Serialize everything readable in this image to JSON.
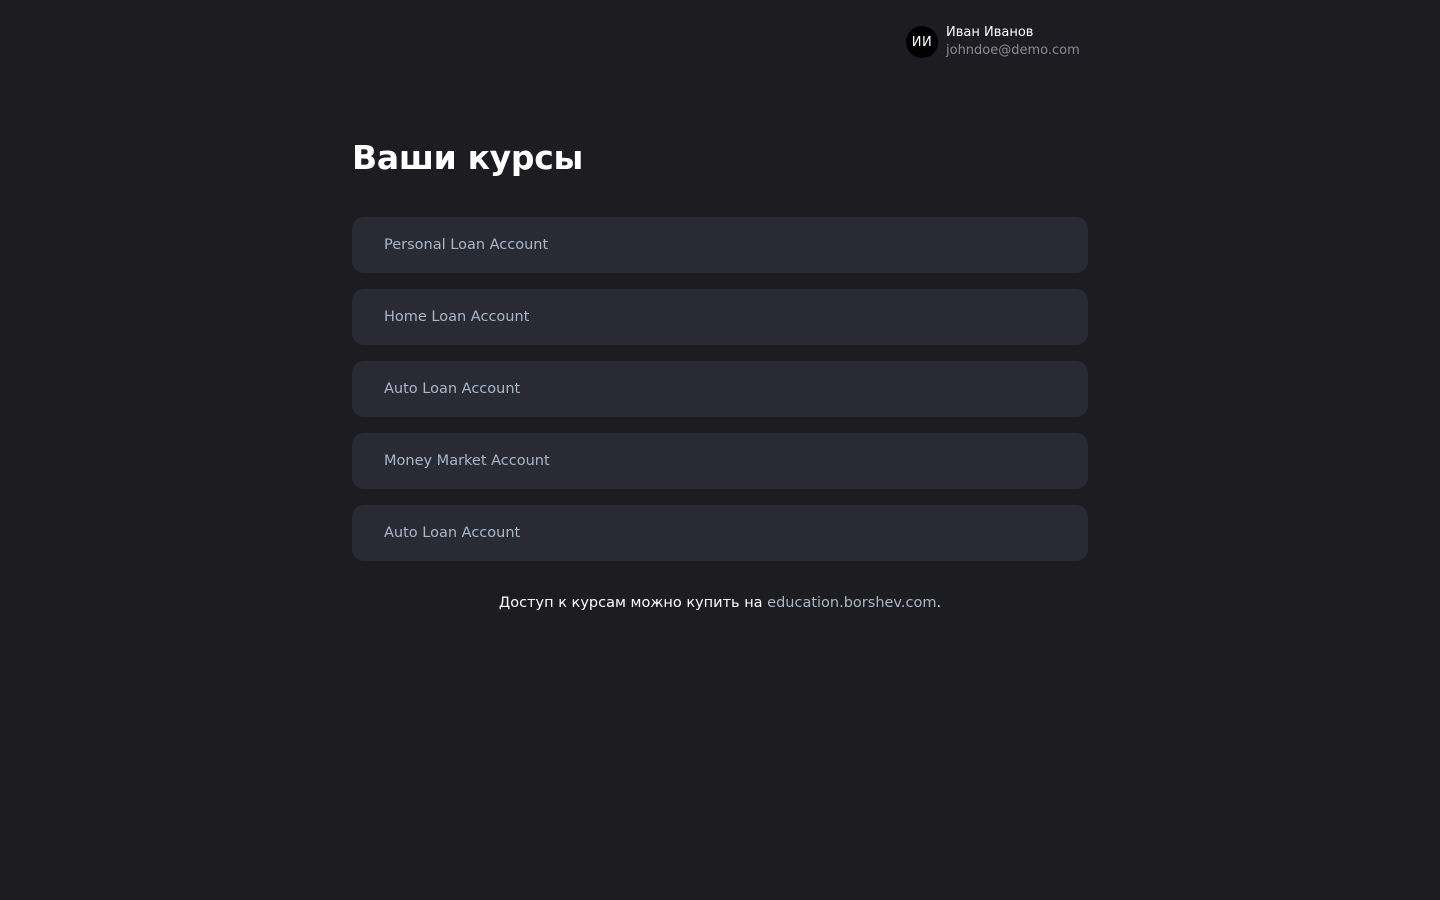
{
  "user": {
    "initials": "ИИ",
    "name": "Иван Иванов",
    "email": "johndoe@demo.com"
  },
  "main": {
    "title": "Ваши курсы",
    "courses": [
      {
        "label": "Personal Loan Account"
      },
      {
        "label": "Home Loan Account"
      },
      {
        "label": "Auto Loan Account"
      },
      {
        "label": "Money Market Account"
      },
      {
        "label": "Auto Loan Account"
      }
    ],
    "footer": {
      "prefix": "Доступ к курсам можно купить на ",
      "link_text": "education.borshev.com",
      "suffix": "."
    }
  },
  "colors": {
    "background": "#1c1c21",
    "card": "#2a2a34",
    "muted_text": "#a9b7c8",
    "secondary_text": "#8a8a93"
  }
}
